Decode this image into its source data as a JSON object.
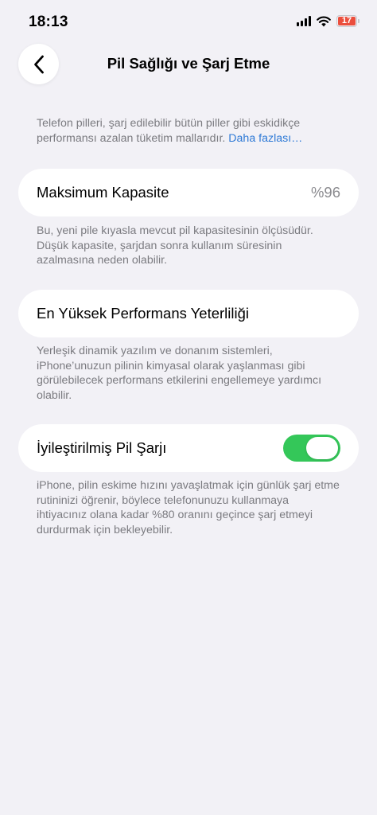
{
  "status_bar": {
    "time": "18:13",
    "battery_level": "17",
    "battery_color": "#eb4e3d"
  },
  "nav": {
    "title": "Pil Sağlığı ve Şarj Etme",
    "back_icon": "chevron-left-icon"
  },
  "intro": {
    "text": "Telefon pilleri, şarj edilebilir bütün piller gibi eskidikçe performansı azalan tüketim mallarıdır. ",
    "link": "Daha fazlası…"
  },
  "max_capacity": {
    "label": "Maksimum Kapasite",
    "value": "%96",
    "description": "Bu, yeni pile kıyasla mevcut pil kapasitesinin ölçüsüdür. Düşük kapasite, şarjdan sonra kullanım süresinin azalmasına neden olabilir."
  },
  "peak_performance": {
    "label": "En Yüksek Performans Yeterliliği",
    "description": "Yerleşik dinamik yazılım ve donanım sistemleri, iPhone’unuzun pilinin kimyasal olarak yaşlanması gibi görülebilecek performans etkilerini engellemeye yardımcı olabilir."
  },
  "optimized_charging": {
    "label": "İyileştirilmiş Pil Şarjı",
    "enabled": true,
    "toggle_color": "#34c759",
    "description": "iPhone, pilin eskime hızını yavaşlatmak için günlük şarj etme rutininizi öğrenir, böylece telefonunuzu kullanmaya ihtiyacınız olana kadar %80 oranını geçince şarj etmeyi durdurmak için bekleyebilir."
  }
}
